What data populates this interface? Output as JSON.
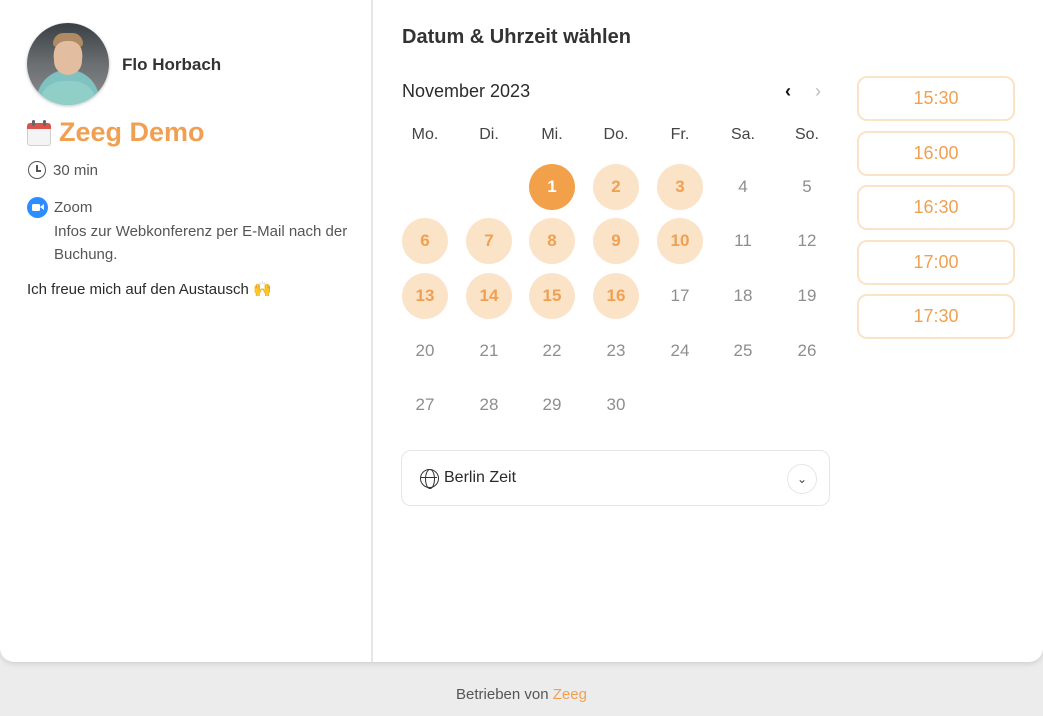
{
  "host": {
    "name": "Flo Horbach"
  },
  "event": {
    "title": "Zeeg Demo",
    "duration": "30 min",
    "location": "Zoom",
    "location_info": "Infos zur Webkonferenz per E-Mail nach der Buchung.",
    "description": "Ich freue mich auf den Austausch 🙌"
  },
  "scheduler": {
    "heading": "Datum & Uhrzeit wählen",
    "month": "November 2023",
    "weekdays": [
      "Mo.",
      "Di.",
      "Mi.",
      "Do.",
      "Fr.",
      "Sa.",
      "So."
    ],
    "days": [
      {
        "label": "1",
        "state": "selected"
      },
      {
        "label": "2",
        "state": "available"
      },
      {
        "label": "3",
        "state": "available"
      },
      {
        "label": "4",
        "state": "disabled"
      },
      {
        "label": "5",
        "state": "disabled"
      },
      {
        "label": "6",
        "state": "available"
      },
      {
        "label": "7",
        "state": "available"
      },
      {
        "label": "8",
        "state": "available"
      },
      {
        "label": "9",
        "state": "available"
      },
      {
        "label": "10",
        "state": "available"
      },
      {
        "label": "11",
        "state": "disabled"
      },
      {
        "label": "12",
        "state": "disabled"
      },
      {
        "label": "13",
        "state": "available"
      },
      {
        "label": "14",
        "state": "available"
      },
      {
        "label": "15",
        "state": "available"
      },
      {
        "label": "16",
        "state": "available"
      },
      {
        "label": "17",
        "state": "disabled"
      },
      {
        "label": "18",
        "state": "disabled"
      },
      {
        "label": "19",
        "state": "disabled"
      },
      {
        "label": "20",
        "state": "disabled"
      },
      {
        "label": "21",
        "state": "disabled"
      },
      {
        "label": "22",
        "state": "disabled"
      },
      {
        "label": "23",
        "state": "disabled"
      },
      {
        "label": "24",
        "state": "disabled"
      },
      {
        "label": "25",
        "state": "disabled"
      },
      {
        "label": "26",
        "state": "disabled"
      },
      {
        "label": "27",
        "state": "disabled"
      },
      {
        "label": "28",
        "state": "disabled"
      },
      {
        "label": "29",
        "state": "disabled"
      },
      {
        "label": "30",
        "state": "disabled"
      }
    ],
    "timezone": "Berlin Zeit",
    "time_slots": [
      "15:30",
      "16:00",
      "16:30",
      "17:00",
      "17:30"
    ]
  },
  "footer": {
    "prefix": "Betrieben von",
    "brand": "Zeeg"
  },
  "colors": {
    "accent": "#f0a052",
    "accent_light": "#fbe3c8",
    "selected": "#f2a14a"
  }
}
